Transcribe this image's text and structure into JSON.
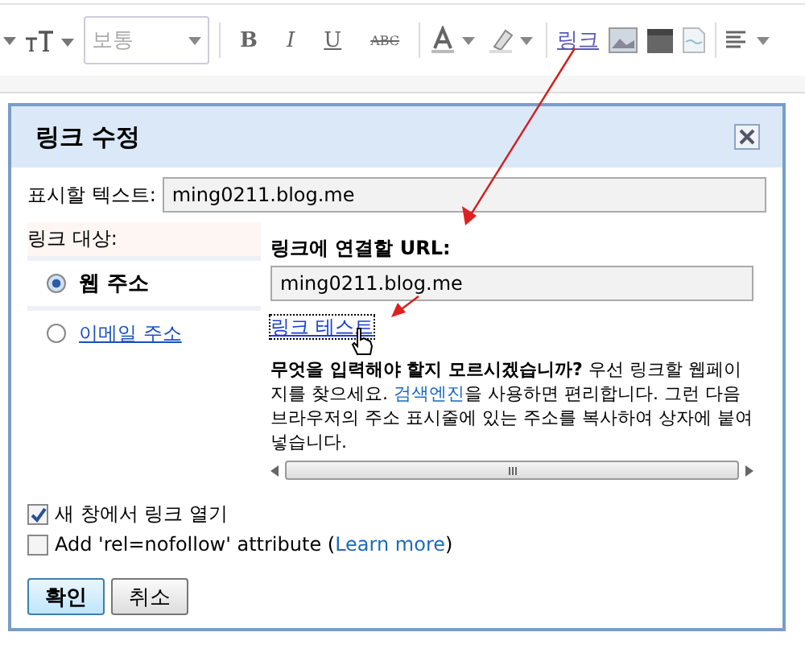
{
  "toolbar": {
    "items": [
      {
        "kind": "caret"
      },
      {
        "kind": "font-size"
      },
      {
        "kind": "select",
        "value": "보통"
      },
      {
        "kind": "sep"
      },
      {
        "kind": "bold",
        "text": "B"
      },
      {
        "kind": "italic",
        "text": "I"
      },
      {
        "kind": "underline",
        "text": "U"
      },
      {
        "kind": "strike",
        "text": "ABC"
      },
      {
        "kind": "sep"
      },
      {
        "kind": "text-color"
      },
      {
        "kind": "highlight"
      },
      {
        "kind": "sep"
      },
      {
        "kind": "link",
        "text": "링크"
      },
      {
        "kind": "image"
      },
      {
        "kind": "video"
      },
      {
        "kind": "sticker"
      },
      {
        "kind": "sep"
      },
      {
        "kind": "align"
      }
    ]
  },
  "dialog": {
    "title": "링크 수정",
    "display_text": {
      "label": "표시할 텍스트:",
      "value": "ming0211.blog.me"
    },
    "link_target": {
      "label": "링크 대상:",
      "options": [
        {
          "label": "웹 주소",
          "selected": true
        },
        {
          "label": "이메일 주소",
          "selected": false
        }
      ]
    },
    "url": {
      "label": "링크에 연결할 URL:",
      "value": "ming0211.blog.me"
    },
    "test_link": "링크 테스트",
    "help": {
      "before": "**무엇을 입력해야 할지 모르시겠습니까?** 우선 링크할 웹페이지를 찾으세요.",
      "link": "검색엔진",
      "after": "을 사용하면 편리합니다. 그런 다음 브라우저의 주소 표시줄에 있는 주소를 복사하여 상자에 붙여넣습니다."
    },
    "options": [
      {
        "label": "새 창에서 링크 열기",
        "checked": true
      },
      {
        "label": "Add 'rel=nofollow' attribute (",
        "link": "Learn more",
        "after": ")",
        "checked": false
      }
    ],
    "buttons": [
      {
        "label": "확인",
        "primary": true
      },
      {
        "label": "취소",
        "primary": false
      }
    ]
  }
}
